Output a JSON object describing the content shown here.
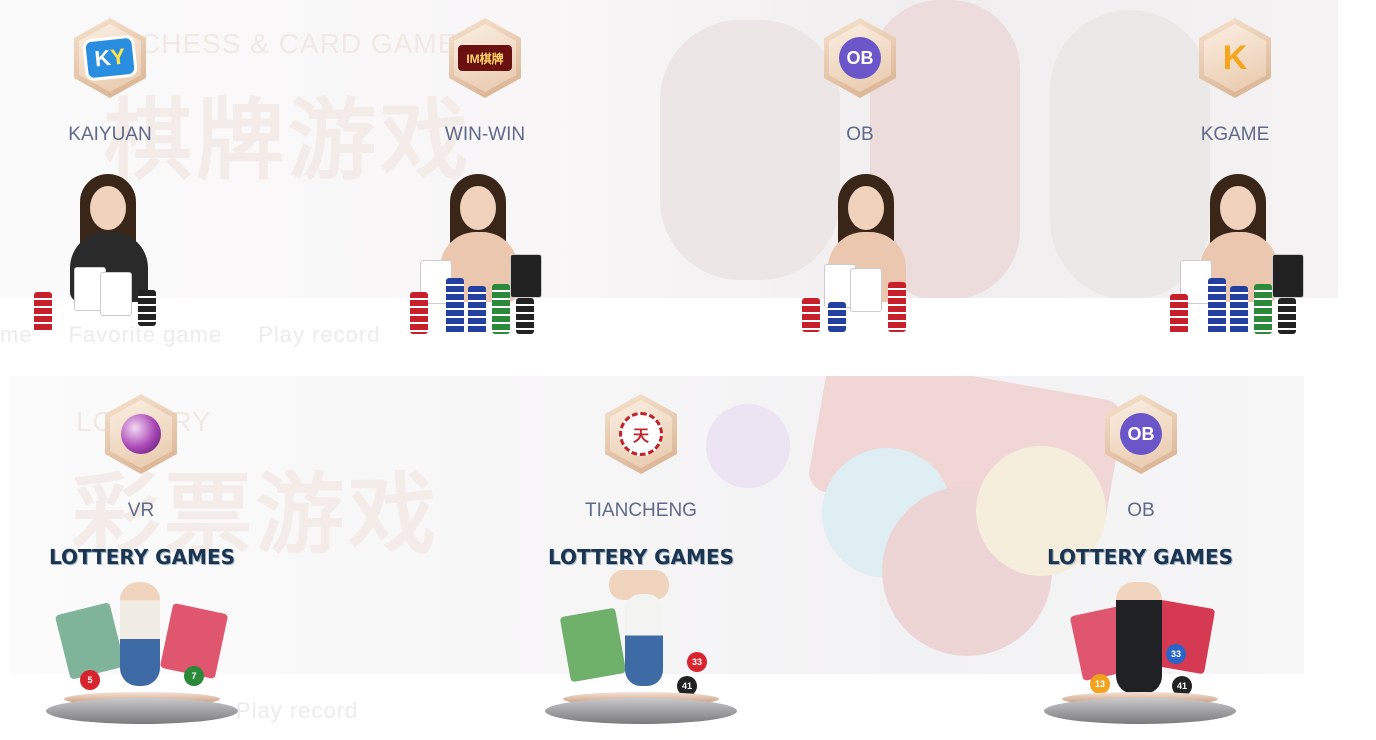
{
  "chess_section": {
    "bg_title_en": "CHESS & CARD GAME",
    "bg_title_cn": "棋牌游戏",
    "tabs": [
      "me",
      "Favorite game",
      "Play record"
    ],
    "providers": [
      {
        "name": "KAIYUAN",
        "logo_text_a": "K",
        "logo_text_b": "Y",
        "icon": "ky-logo-icon"
      },
      {
        "name": "WIN-WIN",
        "logo_text": "IM棋牌",
        "icon": "im-chess-logo-icon"
      },
      {
        "name": "OB",
        "logo_text": "OB",
        "icon": "ob-logo-icon"
      },
      {
        "name": "KGAME",
        "logo_text": "K",
        "icon": "kgame-logo-icon"
      }
    ]
  },
  "lottery_section": {
    "bg_title_en": "LOTTERY",
    "bg_title_cn": "彩票游戏",
    "tabs": [
      "Play record"
    ],
    "providers": [
      {
        "name": "VR",
        "icon": "vr-logo-icon",
        "banner_text": "LOTTERY GAMES"
      },
      {
        "name": "TIANCHENG",
        "logo_text": "天",
        "icon": "tiancheng-logo-icon",
        "banner_text": "LOTTERY GAMES"
      },
      {
        "name": "OB",
        "logo_text": "OB",
        "icon": "ob-logo-icon",
        "banner_text": "LOTTERY GAMES"
      }
    ],
    "ball_numbers": [
      "5",
      "33",
      "41",
      "7",
      "13"
    ]
  },
  "colors": {
    "label": "#5f6a8a",
    "hex_gold": "#d8b08f",
    "ob_purple": "#6b56c9"
  }
}
